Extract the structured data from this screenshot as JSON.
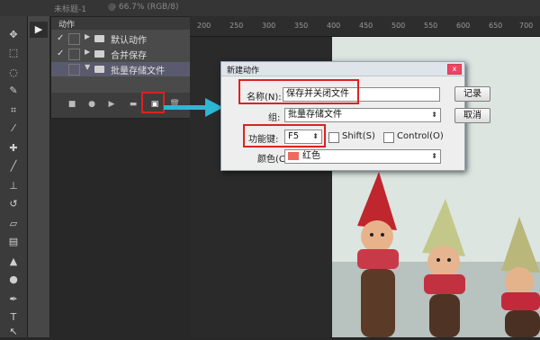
{
  "topbar": {
    "tab1": "未标题-1",
    "tab2": "@ 66.7% (RGB/8)"
  },
  "toolbar": {
    "play_icon": "▶"
  },
  "actions_panel": {
    "title": "动作",
    "rows": [
      {
        "check": "✓",
        "expand": "▶",
        "label": "默认动作"
      },
      {
        "check": "✓",
        "expand": "▶",
        "label": "合并保存"
      },
      {
        "check": "",
        "expand": "▼",
        "label": "批量存储文件"
      }
    ],
    "footer_icons": [
      "■",
      "●",
      "▶",
      "▬",
      "▣",
      "🗑"
    ]
  },
  "ruler": {
    "ticks": [
      "200",
      "250",
      "300",
      "350",
      "400",
      "450",
      "500",
      "550",
      "600",
      "650",
      "700"
    ]
  },
  "dialog": {
    "title": "新建动作",
    "close_label": "x",
    "name_label": "名称(N):",
    "name_value": "保存并关闭文件",
    "set_label": "组:",
    "set_value": "批量存储文件",
    "function_key_label": "功能键:",
    "function_key_value": "F5",
    "shift_label": "Shift(S)",
    "control_label": "Control(O)",
    "color_label": "颜色(C):",
    "color_value": "红色",
    "color_swatch": "#ee6a5e",
    "record_button": "记录",
    "cancel_button": "取消"
  },
  "annotation": {
    "highlight_color": "#e02020",
    "arrow_color": "#2cb7d4"
  }
}
